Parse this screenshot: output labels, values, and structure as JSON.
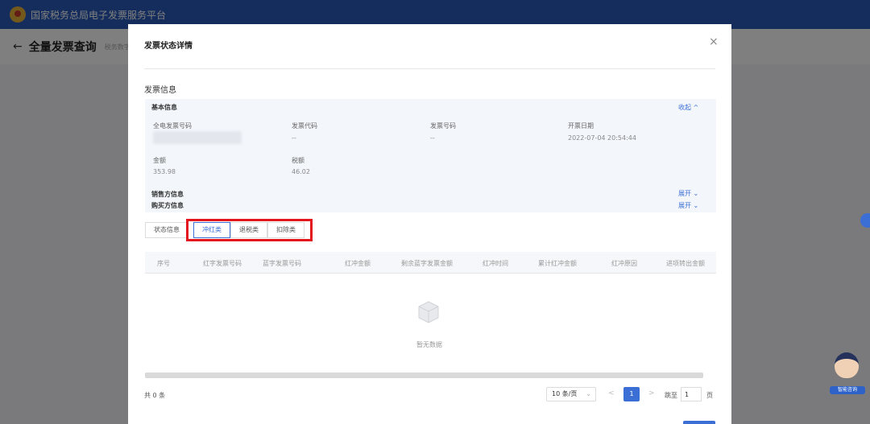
{
  "app": {
    "title": "国家税务总局电子发票服务平台"
  },
  "page": {
    "title": "全量发票查询",
    "subtitle": "税务数字"
  },
  "modal": {
    "title": "发票状态详情",
    "section_title": "发票信息",
    "basic": {
      "label": "基本信息",
      "collapse_label": "收起 ^",
      "fields": {
        "invoice_no_full": {
          "label": "全电发票号码",
          "value": ""
        },
        "invoice_code": {
          "label": "发票代码",
          "value": "--"
        },
        "invoice_number": {
          "label": "发票号码",
          "value": "--"
        },
        "issue_date": {
          "label": "开票日期",
          "value": "2022-07-04 20:54:44"
        },
        "amount": {
          "label": "金额",
          "value": "353.98"
        },
        "tax": {
          "label": "税额",
          "value": "46.02"
        }
      }
    },
    "seller": {
      "label": "销售方信息",
      "expand_label": "展开 ⌄"
    },
    "buyer": {
      "label": "购买方信息",
      "expand_label": "展开 ⌄"
    },
    "tabs": [
      "状态信息",
      "冲红类",
      "退税类",
      "扣除类"
    ],
    "active_tab_index": 1,
    "table": {
      "columns": [
        "序号",
        "红字发票号码",
        "蓝字发票号码",
        "红冲金额",
        "剩余蓝字发票金额",
        "红冲时间",
        "累计红冲金额",
        "红冲原因",
        "进项转出金额"
      ],
      "empty_text": "暂无数据"
    },
    "pagination": {
      "total": "共 0 条",
      "page_size": "10 条/页",
      "prev": "<",
      "current": "1",
      "next": ">",
      "goto_label": "跳至",
      "goto_value": "1",
      "goto_suffix": "页"
    }
  },
  "assistant": {
    "label": "智能咨询"
  },
  "colors": {
    "primary": "#3b6fd6",
    "header": "#2a5bb8",
    "highlight": "#e2161c"
  }
}
